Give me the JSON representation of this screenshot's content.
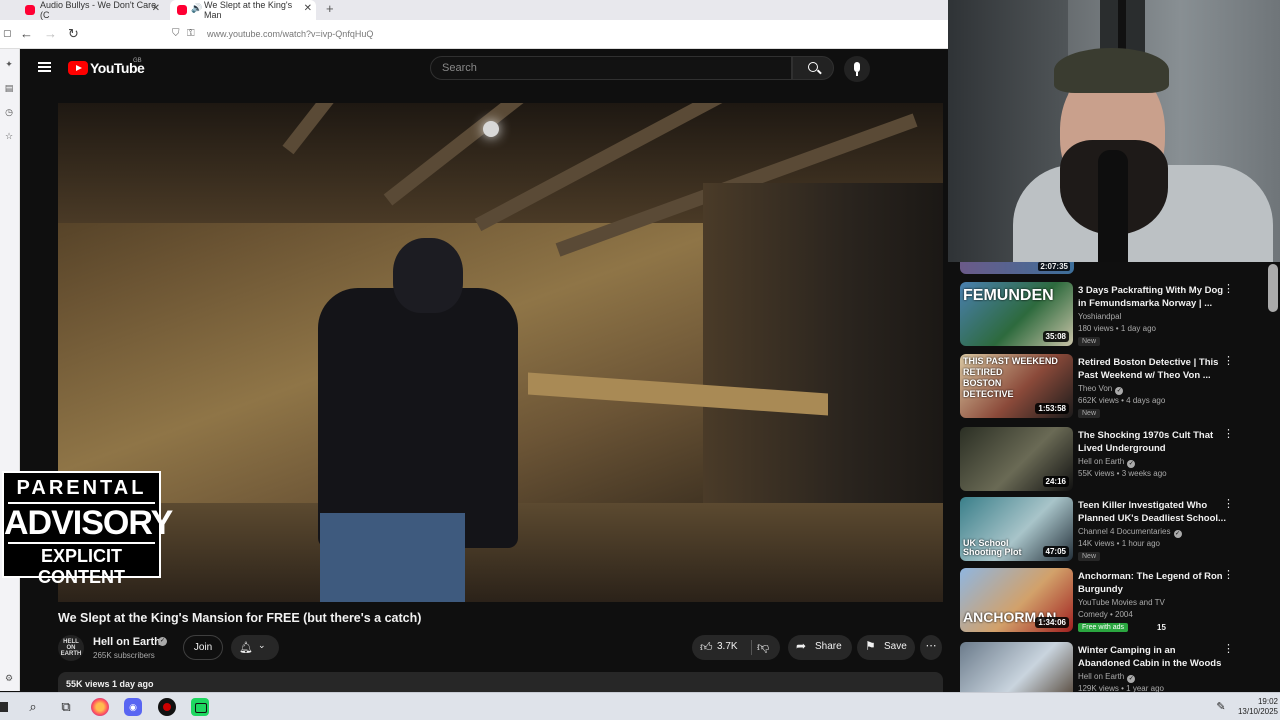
{
  "browser": {
    "tabs": [
      {
        "title": "Audio Bullys - We Don't Care (C"
      },
      {
        "title": "We Slept at the King's Man"
      }
    ],
    "close_glyph": "✕",
    "new_tab_glyph": "+",
    "url": "www.youtube.com/watch?v=ivp-QnfqHuQ",
    "nav_icons": {
      "back": "arrow-left-icon",
      "forward": "arrow-right-icon",
      "reload": "reload-icon"
    }
  },
  "youtube": {
    "logo_text": "YouTube",
    "logo_country": "GB",
    "search_placeholder": "Search"
  },
  "video": {
    "title": "We Slept at the King's Mansion for FREE (but there's a catch)",
    "channel": "Hell on Earth",
    "channel_avatar_text": "HELL ON EARTH",
    "subscribers": "265K subscribers",
    "join_label": "Join",
    "likes": "3.7K",
    "share_label": "Share",
    "save_label": "Save",
    "views_date": "55K views  1 day ago"
  },
  "advisory": {
    "line1": "PARENTAL",
    "line2": "ADVISORY",
    "line3": "EXPLICIT CONTENT"
  },
  "sidebar": {
    "top_peek_duration": "2:07:35",
    "items": [
      {
        "title": "3 Days Packrafting With My Dog in Femundsmarka Norway | ...",
        "channel": "Yoshiandpal",
        "verified": false,
        "meta": "180 views • 1 day ago",
        "badge": "New",
        "duration": "35:08",
        "thumb_text": "FEMUNDEN",
        "thumb_colors": [
          "#4a7fb0",
          "#2d6a3d",
          "#c9c3a8"
        ]
      },
      {
        "title": "Retired Boston Detective | This Past Weekend w/ Theo Von ...",
        "channel": "Theo Von",
        "verified": true,
        "meta": "662K views • 4 days ago",
        "badge": "New",
        "duration": "1:53:58",
        "thumb_text": "THIS PAST WEEKEND\nRETIRED\nBOSTON\nDETECTIVE",
        "thumb_colors": [
          "#d9c7a1",
          "#8b4a3a",
          "#1b1b1b"
        ]
      },
      {
        "title": "The Shocking 1970s Cult That Lived Underground",
        "channel": "Hell on Earth",
        "verified": true,
        "meta": "55K views • 3 weeks ago",
        "badge": "",
        "duration": "24:16",
        "thumb_text": "",
        "thumb_colors": [
          "#2b2f24",
          "#6a6a55",
          "#111111"
        ]
      },
      {
        "title": "Teen Killer Investigated Who Planned UK's Deadliest School...",
        "channel": "Channel 4 Documentaries",
        "verified": true,
        "meta": "14K views • 1 hour ago",
        "badge": "New",
        "duration": "47:05",
        "thumb_text": "UK School\nShooting Plot",
        "thumb_colors": [
          "#3a7f8a",
          "#a8c4c9",
          "#24303a"
        ]
      },
      {
        "title": "Anchorman: The Legend of Ron Burgundy",
        "channel": "YouTube Movies and TV",
        "verified": false,
        "meta": "Comedy • 2004",
        "badge": "Free with ads",
        "badge_extra": "15",
        "duration": "1:34:06",
        "thumb_text": "ANCHORMAN",
        "thumb_colors": [
          "#8fb6e0",
          "#d2a16a",
          "#a02020"
        ]
      },
      {
        "title": "Winter Camping in an Abandoned Cabin in the Woods",
        "channel": "Hell on Earth",
        "verified": true,
        "meta": "129K views • 1 year ago",
        "badge": "",
        "duration": "",
        "thumb_text": "",
        "thumb_colors": [
          "#6b7b8b",
          "#c9d4de",
          "#4a3a2a"
        ]
      }
    ]
  },
  "taskbar": {
    "time": "19:02",
    "date": "13/10/2025"
  }
}
